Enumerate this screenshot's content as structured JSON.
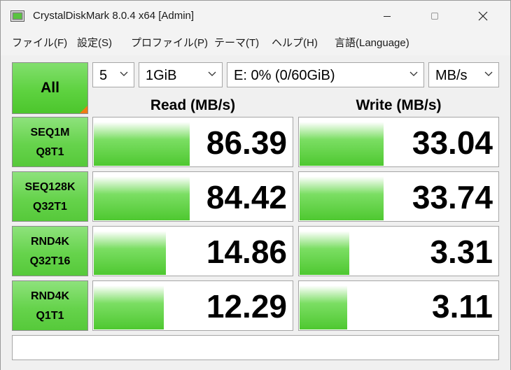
{
  "window": {
    "title": "CrystalDiskMark 8.0.4 x64 [Admin]"
  },
  "menu": [
    {
      "label": "ファイル(F)"
    },
    {
      "label": "設定(S)"
    },
    {
      "label": "プロファイル(P)"
    },
    {
      "label": "テーマ(T)"
    },
    {
      "label": "ヘルプ(H)"
    },
    {
      "label": "言語(Language)"
    }
  ],
  "controls": {
    "all_label": "All",
    "count": "5",
    "size": "1GiB",
    "drive": "E: 0% (0/60GiB)",
    "unit": "MB/s"
  },
  "headers": {
    "read": "Read (MB/s)",
    "write": "Write (MB/s)"
  },
  "tests": [
    {
      "line1": "SEQ1M",
      "line2": "Q8T1",
      "read": "86.39",
      "write": "33.04",
      "read_level": 0.48,
      "write_level": 0.42
    },
    {
      "line1": "SEQ128K",
      "line2": "Q32T1",
      "read": "84.42",
      "write": "33.74",
      "read_level": 0.48,
      "write_level": 0.42
    },
    {
      "line1": "RND4K",
      "line2": "Q32T16",
      "read": "14.86",
      "write": "3.31",
      "read_level": 0.36,
      "write_level": 0.25
    },
    {
      "line1": "RND4K",
      "line2": "Q1T1",
      "read": "12.29",
      "write": "3.11",
      "read_level": 0.35,
      "write_level": 0.24
    }
  ],
  "comment": "",
  "colors": {
    "bar_green": "#4ec830",
    "button_green": "#66d34c",
    "corner_orange": "#f07a14"
  },
  "icons": {
    "app": "crystaldiskmark-app-icon",
    "minimize": "minimize-icon",
    "maximize": "maximize-icon",
    "close": "close-icon",
    "dropdown": "chevron-down-icon"
  }
}
